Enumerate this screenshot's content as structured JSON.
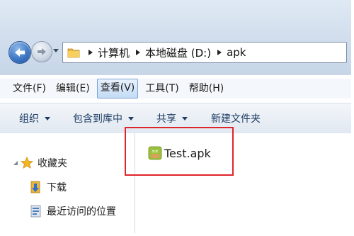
{
  "address": {
    "crumbs": [
      "计算机",
      "本地磁盘 (D:)",
      "apk"
    ]
  },
  "menu": {
    "items": [
      "文件(F)",
      "编辑(E)",
      "查看(V)",
      "工具(T)",
      "帮助(H)"
    ],
    "active_index": 2
  },
  "toolbar": {
    "organize": "组织",
    "include_library": "包含到库中",
    "share": "共享",
    "new_folder": "新建文件夹"
  },
  "nav": {
    "favorites": "收藏夹",
    "downloads": "下载",
    "recent": "最近访问的位置"
  },
  "files": [
    {
      "name": "Test.apk",
      "icon": "apk-android-icon"
    }
  ],
  "colors": {
    "highlight": "#e0242b",
    "accent": "#3e78c6"
  }
}
